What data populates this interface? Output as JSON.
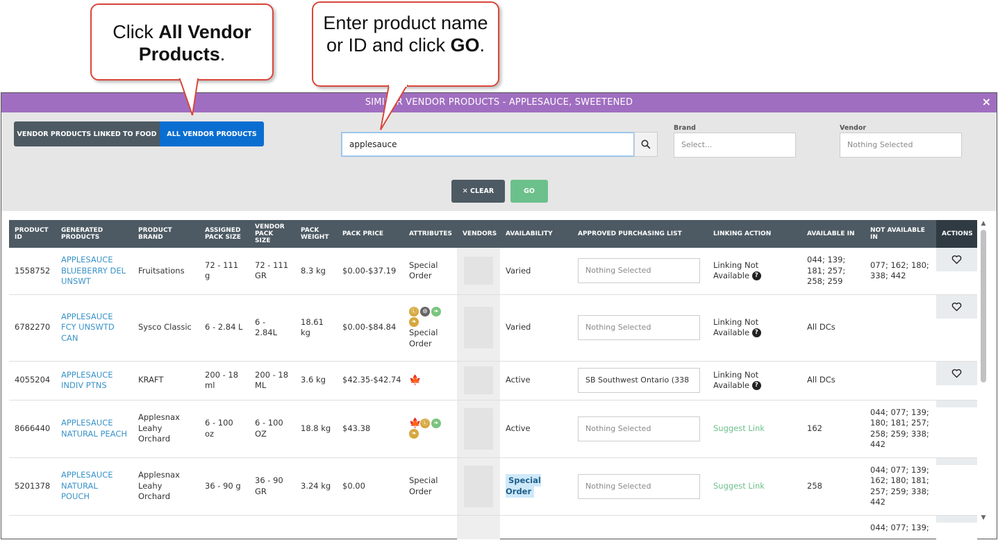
{
  "callouts": {
    "first": {
      "pre": "Click ",
      "bold": "All Vendor Products",
      "post": "."
    },
    "second": {
      "pre": "Enter product name or ID and click ",
      "bold": "GO",
      "post": "."
    }
  },
  "modal": {
    "title": "SIMILAR VENDOR PRODUCTS - APPLESAUCE, SWEETENED",
    "close_label": "×"
  },
  "filters": {
    "tab_linked": "VENDOR PRODUCTS LINKED TO FOOD",
    "tab_all": "ALL VENDOR PRODUCTS",
    "search_value": "applesauce",
    "brand_label": "Brand",
    "brand_placeholder": "Select...",
    "vendor_label": "Vendor",
    "vendor_placeholder": "Nothing Selected",
    "clear_label": "✕ CLEAR",
    "go_label": "GO"
  },
  "table": {
    "headers": {
      "product_id": "PRODUCT ID",
      "generated": "GENERATED PRODUCTS",
      "brand": "PRODUCT BRAND",
      "assigned": "ASSIGNED PACK SIZE",
      "vendor_pack": "VENDOR PACK SIZE",
      "weight": "PACK WEIGHT",
      "price": "PACK PRICE",
      "attributes": "ATTRIBUTES",
      "vendors": "VENDORS",
      "availability": "AVAILABILITY",
      "purchasing": "APPROVED PURCHASING LIST",
      "linking": "LINKING ACTION",
      "available": "AVAILABLE IN",
      "not_available": "NOT AVAILABLE IN",
      "actions": "ACTIONS"
    },
    "rows": [
      {
        "id": "1558752",
        "name": "APPLESAUCE BLUEBERRY DEL UNSWT",
        "brand": "Fruitsations",
        "assigned": "72 - 111 g",
        "vendor_pack": "72 - 111 GR",
        "weight": "8.3 kg",
        "price": "$0.00-$37.19",
        "attributes": "Special Order",
        "availability": "Varied",
        "purchasing": "Nothing Selected",
        "linking": "Linking Not Available",
        "available": "044; 139; 181; 257; 258; 259",
        "not_available": "077; 162; 180; 338; 442"
      },
      {
        "id": "6782270",
        "name": "APPLESAUCE FCY UNSWTD CAN",
        "brand": "Sysco Classic",
        "assigned": "6 - 2.84 L",
        "vendor_pack": "6 - 2.84L",
        "weight": "18.61 kg",
        "price": "$0.00-$84.84",
        "attributes": "Special Order",
        "availability": "Varied",
        "purchasing": "Nothing Selected",
        "linking": "Linking Not Available",
        "available": "All DCs",
        "not_available": ""
      },
      {
        "id": "4055204",
        "name": "APPLESAUCE INDIV PTNS",
        "brand": "KRAFT",
        "assigned": "200 - 18 ml",
        "vendor_pack": "200 - 18 ML",
        "weight": "3.6 kg",
        "price": "$42.35-$42.74",
        "attributes": "",
        "availability": "Active",
        "purchasing": "SB Southwest Ontario (338",
        "linking": "Linking Not Available",
        "available": "All DCs",
        "not_available": ""
      },
      {
        "id": "8666440",
        "name": "APPLESAUCE NATURAL PEACH",
        "brand": "Applesnax Leahy Orchard",
        "assigned": "6 - 100 oz",
        "vendor_pack": "6 - 100 OZ",
        "weight": "18.8 kg",
        "price": "$43.38",
        "attributes": "",
        "availability": "Active",
        "purchasing": "Nothing Selected",
        "linking": "Suggest Link",
        "available": "162",
        "not_available": "044; 077; 139; 180; 181; 257; 258; 259; 338; 442"
      },
      {
        "id": "5201378",
        "name": "APPLESAUCE NATURAL POUCH",
        "brand": "Applesnax Leahy Orchard",
        "assigned": "36 - 90 g",
        "vendor_pack": "36 - 90 GR",
        "weight": "3.24 kg",
        "price": "$0.00",
        "attributes": "Special Order",
        "availability": "Special Order",
        "purchasing": "Nothing Selected",
        "linking": "Suggest Link",
        "available": "258",
        "not_available": "044; 077; 139; 162; 180; 181; 257; 259; 338; 442"
      },
      {
        "not_available": "044; 077; 139;"
      }
    ]
  },
  "icons": {
    "search": "search-icon",
    "heart": "heart-icon",
    "help": "?",
    "maple": "🍁",
    "gold": "Ⓛ",
    "dark": "⊛",
    "leaf": "❧"
  },
  "colors": {
    "modal_header": "#a06ec0",
    "toggle_active": "#0a6ed1",
    "go_button": "#6cc08b",
    "link": "#3a93c9",
    "callout_border": "#d9463b"
  }
}
